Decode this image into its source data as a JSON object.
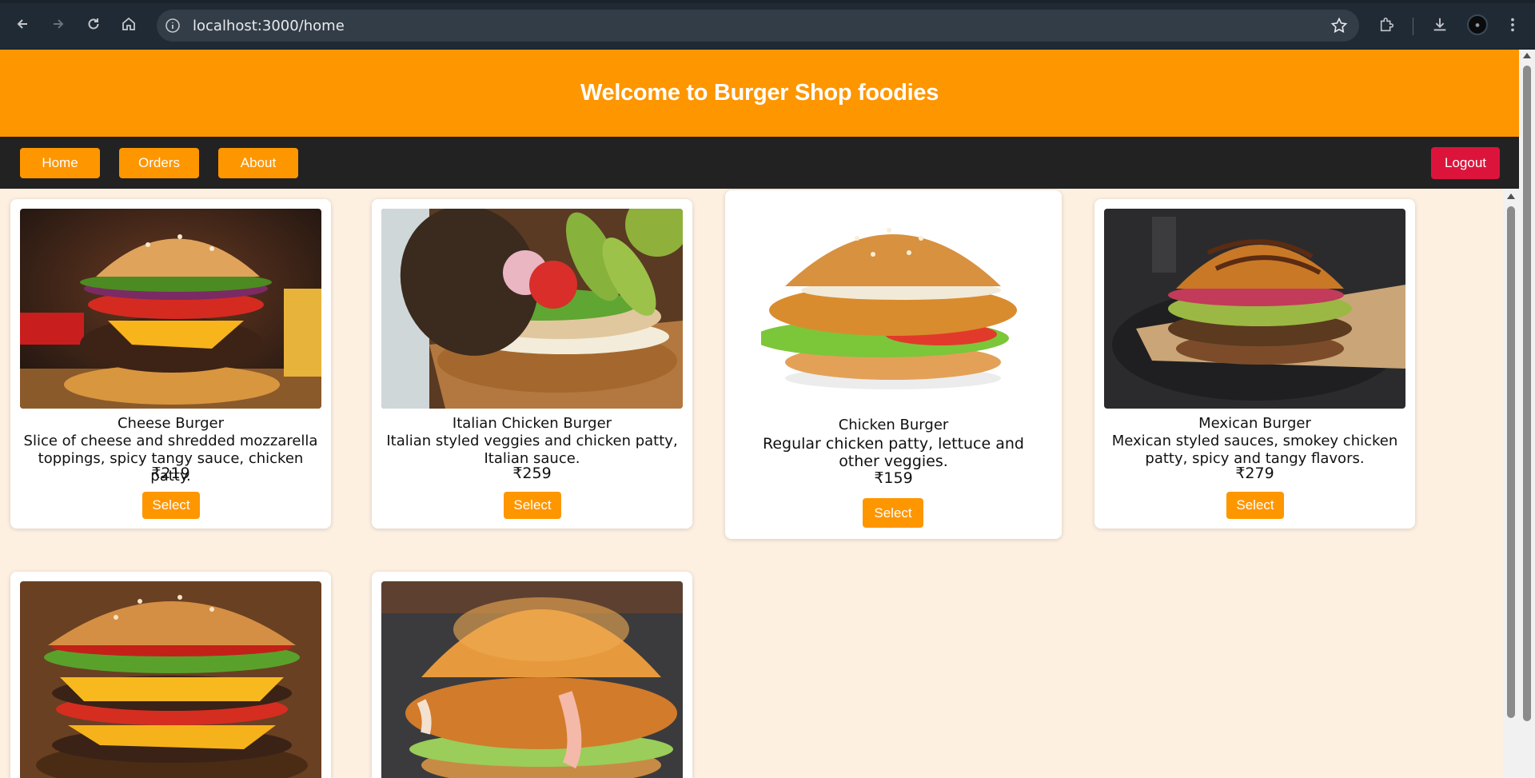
{
  "browser": {
    "url": "localhost:3000/home"
  },
  "header": {
    "title": "Welcome to Burger Shop foodies"
  },
  "nav": {
    "home_label": "Home",
    "orders_label": "Orders",
    "about_label": "About",
    "logout_label": "Logout"
  },
  "products": [
    {
      "name": "Cheese Burger",
      "description": "Slice of cheese and shredded mozzarella toppings, spicy tangy sauce, chicken patty.",
      "price": "₹219",
      "button": "Select"
    },
    {
      "name": "Italian Chicken Burger",
      "description": "Italian styled veggies and chicken patty, Italian sauce.",
      "price": "₹259",
      "button": "Select"
    },
    {
      "name": "Chicken Burger",
      "description": "Regular chicken patty, lettuce and other veggies.",
      "price": "₹159",
      "button": "Select"
    },
    {
      "name": "Mexican Burger",
      "description": "Mexican styled sauces, smokey chicken patty, spicy and tangy flavors.",
      "price": "₹279",
      "button": "Select"
    }
  ],
  "colors": {
    "header": "#fe9600",
    "nav_bg": "#222222",
    "logout": "#dc143c",
    "page_bg": "#fdf0e1"
  }
}
